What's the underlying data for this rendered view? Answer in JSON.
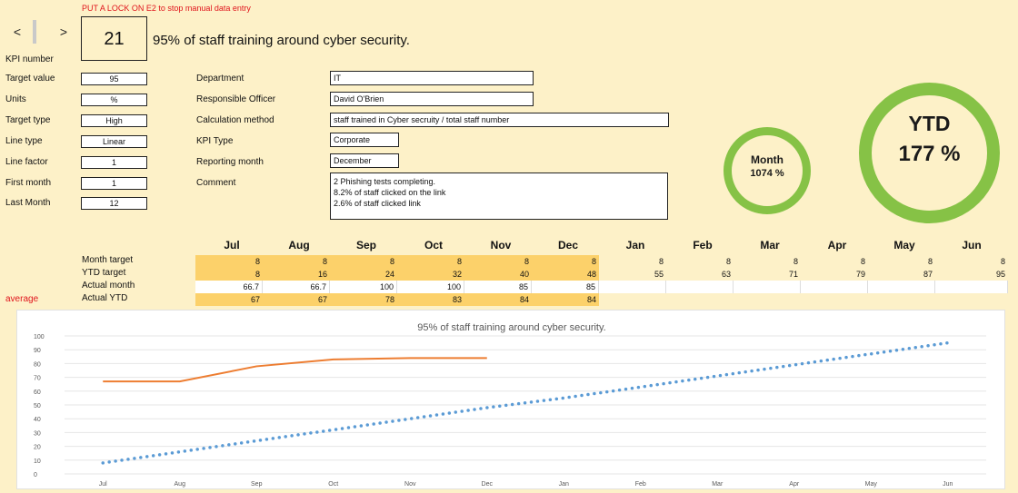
{
  "warning": "PUT A LOCK ON E2 to stop manual data entry",
  "nav": {
    "prev": "<",
    "next": ">"
  },
  "kpi": {
    "number": "21",
    "number_label": "KPI number",
    "title": "95% of staff training around cyber security."
  },
  "fields_left": [
    {
      "label": "Target value",
      "value": "95"
    },
    {
      "label": "Units",
      "value": "%"
    },
    {
      "label": "Target type",
      "value": "High"
    },
    {
      "label": "Line type",
      "value": "Linear"
    },
    {
      "label": "Line factor",
      "value": "1"
    },
    {
      "label": "First month",
      "value": "1"
    },
    {
      "label": "Last Month",
      "value": "12"
    }
  ],
  "fields_right": [
    {
      "label": "Department",
      "value": "IT"
    },
    {
      "label": "Responsible Officer",
      "value": "David O'Brien"
    },
    {
      "label": "Calculation method",
      "value": "staff trained in Cyber secruity / total staff number"
    },
    {
      "label": "KPI Type",
      "value": "Corporate"
    },
    {
      "label": "Reporting month",
      "value": "December"
    }
  ],
  "comment": {
    "label": "Comment",
    "lines": [
      "2 Phishing tests completing.",
      "8.2% of staff clicked on the link",
      "2.6% of staff clicked link"
    ]
  },
  "gauges": {
    "month_label": "Month",
    "month_value": "1074 %",
    "ytd_label": "YTD",
    "ytd_value": "177 %",
    "ring_color": "#86c246"
  },
  "table": {
    "months": [
      "Jul",
      "Aug",
      "Sep",
      "Oct",
      "Nov",
      "Dec",
      "Jan",
      "Feb",
      "Mar",
      "Apr",
      "May",
      "Jun"
    ],
    "rows": [
      {
        "label": "Month target",
        "values": [
          "8",
          "8",
          "8",
          "8",
          "8",
          "8",
          "8",
          "8",
          "8",
          "8",
          "8",
          "8"
        ]
      },
      {
        "label": "YTD target",
        "values": [
          "8",
          "16",
          "24",
          "32",
          "40",
          "48",
          "55",
          "63",
          "71",
          "79",
          "87",
          "95"
        ]
      },
      {
        "label": "Actual month",
        "values": [
          "66.7",
          "66.7",
          "100",
          "100",
          "85",
          "85",
          "",
          "",
          "",
          "",
          "",
          ""
        ]
      },
      {
        "label": "Actual YTD",
        "values": [
          "67",
          "67",
          "78",
          "83",
          "84",
          "84",
          "",
          "",
          "",
          "",
          "",
          ""
        ]
      }
    ],
    "average_label": "average",
    "highlight_color": "#fcd16a"
  },
  "chart_data": {
    "type": "line",
    "title": "95% of staff training around cyber security.",
    "categories": [
      "Jul",
      "Aug",
      "Sep",
      "Oct",
      "Nov",
      "Dec",
      "Jan",
      "Feb",
      "Mar",
      "Apr",
      "May",
      "Jun"
    ],
    "series": [
      {
        "values": [
          67,
          67,
          78,
          83,
          84,
          84,
          null,
          null,
          null,
          null,
          null,
          null
        ],
        "color": "#ed7d31",
        "style": "solid"
      },
      {
        "values": [
          8,
          16,
          24,
          32,
          40,
          48,
          55,
          63,
          71,
          79,
          87,
          95
        ],
        "color": "#5b9bd5",
        "style": "dotted"
      }
    ],
    "ylim": [
      0,
      100
    ],
    "yticks": [
      0,
      10,
      20,
      30,
      40,
      50,
      60,
      70,
      80,
      90,
      100
    ],
    "grid": true,
    "legend": "none"
  }
}
